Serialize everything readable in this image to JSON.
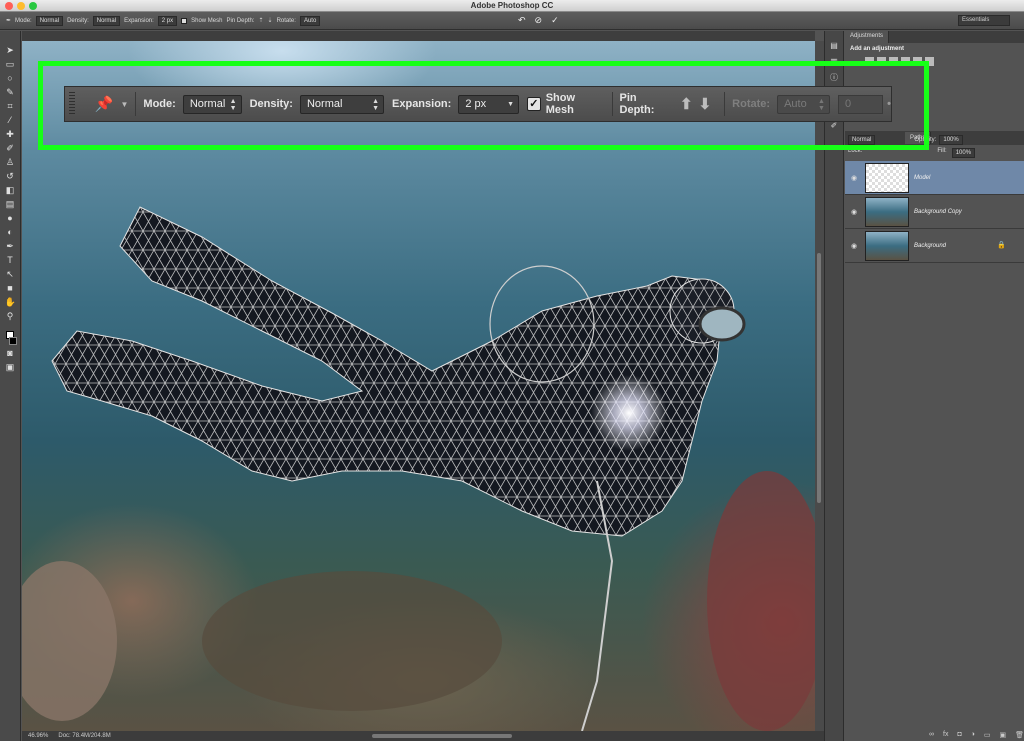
{
  "app": {
    "title": "Adobe Photoshop CC",
    "traffic_lights": [
      "#ff5f57",
      "#febc2e",
      "#28c840"
    ]
  },
  "small_options": {
    "mode_label": "Mode:",
    "mode_value": "Normal",
    "density_label": "Density:",
    "density_value": "Normal",
    "expansion_label": "Expansion:",
    "expansion_value": "2 px",
    "show_mesh_label": "Show Mesh",
    "pin_depth_label": "Pin Depth:",
    "rotate_label": "Rotate:",
    "rotate_value": "Auto",
    "workspace": "Essentials"
  },
  "toolbar": {
    "mode_label": "Mode:",
    "mode_value": "Normal",
    "density_label": "Density:",
    "density_value": "Normal",
    "expansion_label": "Expansion:",
    "expansion_value": "2 px",
    "show_mesh_label": "Show Mesh",
    "show_mesh_checked": true,
    "pin_depth_label": "Pin Depth:",
    "rotate_label": "Rotate:",
    "rotate_value": "Auto",
    "rotate_angle": "0",
    "highlight_color": "#17ff17"
  },
  "status": {
    "zoom": "46.96%",
    "doc_size": "Doc: 78.4M/204.8M"
  },
  "panels": {
    "tab_adjustments": "Adjustments",
    "add_adjustment": "Add an adjustment",
    "tab_paths": "Paths",
    "blend_mode": "Normal",
    "opacity_label": "Opacity:",
    "opacity_value": "100%",
    "lock_label": "Lock:",
    "fill_label": "Fill:",
    "fill_value": "100%",
    "layers": [
      {
        "name": "Model",
        "selected": true
      },
      {
        "name": "Background Copy",
        "selected": false
      },
      {
        "name": "Background",
        "selected": false,
        "locked": true
      }
    ]
  },
  "icons": {
    "pin": "pushpin-icon",
    "pin_forward": "pin-forward-icon",
    "pin_backward": "pin-backward-icon",
    "undo": "undo-icon",
    "cancel": "cancel-icon",
    "commit": "checkmark-icon"
  }
}
